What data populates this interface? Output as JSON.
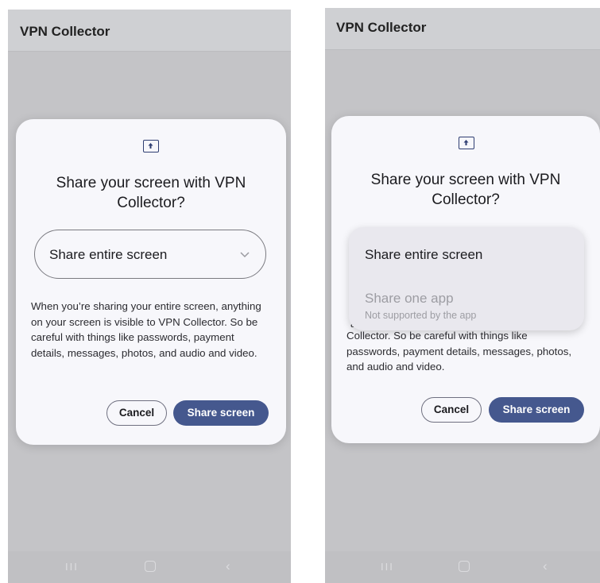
{
  "left_screen": {
    "app_title": "VPN Collector",
    "dialog": {
      "title": "Share your screen with VPN Collector?",
      "dropdown_value": "Share entire screen",
      "description": "When you’re sharing your entire screen, anything on your screen is visible to VPN Collector. So be careful with things like passwords, payment details, messages, photos, and audio and video.",
      "cancel_label": "Cancel",
      "share_label": "Share screen"
    },
    "nav": {
      "recents": "III",
      "home": "",
      "back": "‹"
    }
  },
  "right_screen": {
    "app_title": "VPN Collector",
    "dialog": {
      "title": "Share your screen with VPN Collector?",
      "menu_options": [
        {
          "label": "Share entire screen",
          "enabled": true
        },
        {
          "label": "Share one app",
          "sublabel": "Not supported by the app",
          "enabled": false
        }
      ],
      "partial_letter": "a",
      "description": "Collector. So be careful with things like passwords, payment details, messages, photos, and audio and video.",
      "cancel_label": "Cancel",
      "share_label": "Share screen"
    },
    "nav": {
      "recents": "III",
      "home": "",
      "back": "‹"
    }
  },
  "colors": {
    "primary": "#45588e",
    "dialog_bg": "#f7f7fb",
    "scrim": "#c4c4c7",
    "menu_bg": "#e9e8ee",
    "disabled_text": "#9d9da3"
  },
  "icons": {
    "dialog_icon": "screen-share-icon",
    "dropdown_icon": "chevron-down-icon"
  }
}
